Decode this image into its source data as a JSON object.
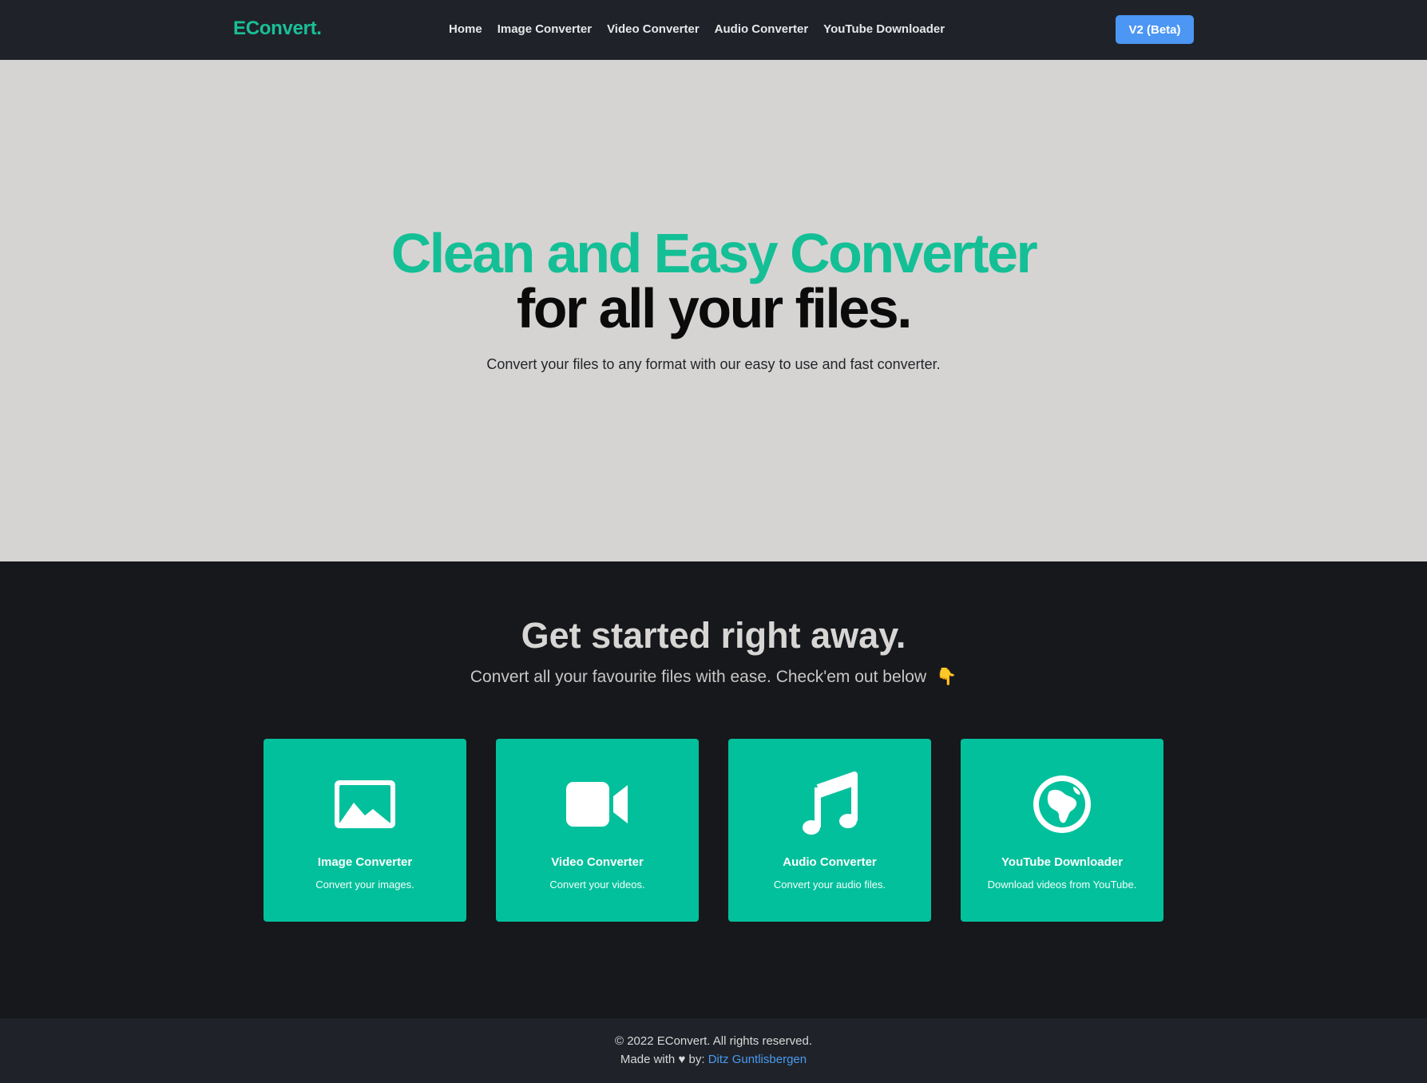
{
  "navbar": {
    "brand": "EConvert.",
    "links": [
      {
        "label": "Home"
      },
      {
        "label": "Image Converter"
      },
      {
        "label": "Video Converter"
      },
      {
        "label": "Audio Converter"
      },
      {
        "label": "YouTube Downloader"
      }
    ],
    "version_button": "V2 (Beta)"
  },
  "hero": {
    "line1": "Clean and Easy Converter",
    "line2": "for all your files.",
    "subtitle": "Convert your files to any format with our easy to use and fast converter."
  },
  "get_started": {
    "title": "Get started right away.",
    "subtitle": "Convert all your favourite files with ease. Check'em out below",
    "subtitle_emoji": "👇",
    "cards": [
      {
        "title": "Image Converter",
        "description": "Convert your images.",
        "icon": "image-icon"
      },
      {
        "title": "Video Converter",
        "description": "Convert your videos.",
        "icon": "video-camera-icon"
      },
      {
        "title": "Audio Converter",
        "description": "Convert your audio files.",
        "icon": "music-note-icon"
      },
      {
        "title": "YouTube Downloader",
        "description": "Download videos from YouTube.",
        "icon": "globe-icon"
      }
    ]
  },
  "footer": {
    "copyright": "© 2022 EConvert. All rights reserved.",
    "made_with_prefix": "Made with",
    "heart": "♥",
    "by_text": "by:",
    "author": "Ditz Guntlisbergen"
  },
  "colors": {
    "accent": "#03c09c",
    "hero_green": "#14bf96",
    "button_blue": "#4c96f4",
    "dark_bg": "#16181c",
    "nav_bg": "#1f2329",
    "hero_bg": "#d6d4d3",
    "link_blue": "#4b9af0"
  }
}
